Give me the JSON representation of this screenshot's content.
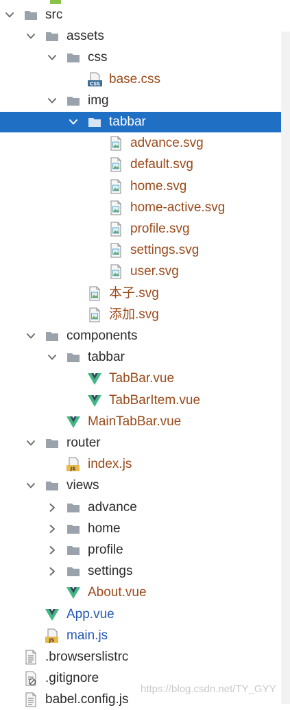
{
  "tree": [
    {
      "label": "src",
      "depth": 0,
      "kind": "folder",
      "state": "expanded",
      "color": "normal",
      "icon": "folder-icon"
    },
    {
      "label": "assets",
      "depth": 1,
      "kind": "folder",
      "state": "expanded",
      "color": "normal",
      "icon": "folder-icon"
    },
    {
      "label": "css",
      "depth": 2,
      "kind": "folder",
      "state": "expanded",
      "color": "normal",
      "icon": "folder-icon"
    },
    {
      "label": "base.css",
      "depth": 3,
      "kind": "file",
      "state": "none",
      "color": "modified",
      "icon": "css-file-icon"
    },
    {
      "label": "img",
      "depth": 2,
      "kind": "folder",
      "state": "expanded",
      "color": "normal",
      "icon": "folder-icon"
    },
    {
      "label": "tabbar",
      "depth": 3,
      "kind": "folder",
      "state": "expanded",
      "color": "normal",
      "icon": "folder-icon",
      "selected": true
    },
    {
      "label": "advance.svg",
      "depth": 4,
      "kind": "file",
      "state": "none",
      "color": "modified",
      "icon": "image-file-icon"
    },
    {
      "label": "default.svg",
      "depth": 4,
      "kind": "file",
      "state": "none",
      "color": "modified",
      "icon": "image-file-icon"
    },
    {
      "label": "home.svg",
      "depth": 4,
      "kind": "file",
      "state": "none",
      "color": "modified",
      "icon": "image-file-icon"
    },
    {
      "label": "home-active.svg",
      "depth": 4,
      "kind": "file",
      "state": "none",
      "color": "modified",
      "icon": "image-file-icon"
    },
    {
      "label": "profile.svg",
      "depth": 4,
      "kind": "file",
      "state": "none",
      "color": "modified",
      "icon": "image-file-icon"
    },
    {
      "label": "settings.svg",
      "depth": 4,
      "kind": "file",
      "state": "none",
      "color": "modified",
      "icon": "image-file-icon"
    },
    {
      "label": "user.svg",
      "depth": 4,
      "kind": "file",
      "state": "none",
      "color": "modified",
      "icon": "image-file-icon"
    },
    {
      "label": "本子.svg",
      "depth": 3,
      "kind": "file",
      "state": "none",
      "color": "modified",
      "icon": "image-file-icon"
    },
    {
      "label": "添加.svg",
      "depth": 3,
      "kind": "file",
      "state": "none",
      "color": "modified",
      "icon": "image-file-icon"
    },
    {
      "label": "components",
      "depth": 1,
      "kind": "folder",
      "state": "expanded",
      "color": "normal",
      "icon": "folder-icon"
    },
    {
      "label": "tabbar",
      "depth": 2,
      "kind": "folder",
      "state": "expanded",
      "color": "normal",
      "icon": "folder-icon"
    },
    {
      "label": "TabBar.vue",
      "depth": 3,
      "kind": "file",
      "state": "none",
      "color": "modified",
      "icon": "vue-file-icon"
    },
    {
      "label": "TabBarItem.vue",
      "depth": 3,
      "kind": "file",
      "state": "none",
      "color": "modified",
      "icon": "vue-file-icon"
    },
    {
      "label": "MainTabBar.vue",
      "depth": 2,
      "kind": "file",
      "state": "none",
      "color": "modified",
      "icon": "vue-file-icon"
    },
    {
      "label": "router",
      "depth": 1,
      "kind": "folder",
      "state": "expanded",
      "color": "normal",
      "icon": "folder-icon"
    },
    {
      "label": "index.js",
      "depth": 2,
      "kind": "file",
      "state": "none",
      "color": "modified",
      "icon": "js-file-icon"
    },
    {
      "label": "views",
      "depth": 1,
      "kind": "folder",
      "state": "expanded",
      "color": "normal",
      "icon": "folder-icon"
    },
    {
      "label": "advance",
      "depth": 2,
      "kind": "folder",
      "state": "collapsed",
      "color": "normal",
      "icon": "folder-icon"
    },
    {
      "label": "home",
      "depth": 2,
      "kind": "folder",
      "state": "collapsed",
      "color": "normal",
      "icon": "folder-icon"
    },
    {
      "label": "profile",
      "depth": 2,
      "kind": "folder",
      "state": "collapsed",
      "color": "normal",
      "icon": "folder-icon"
    },
    {
      "label": "settings",
      "depth": 2,
      "kind": "folder",
      "state": "collapsed",
      "color": "normal",
      "icon": "folder-icon"
    },
    {
      "label": "About.vue",
      "depth": 2,
      "kind": "file",
      "state": "none",
      "color": "modified",
      "icon": "vue-file-icon"
    },
    {
      "label": "App.vue",
      "depth": 1,
      "kind": "file",
      "state": "none",
      "color": "new",
      "icon": "vue-file-icon"
    },
    {
      "label": "main.js",
      "depth": 1,
      "kind": "file",
      "state": "none",
      "color": "new",
      "icon": "js-file-icon"
    },
    {
      "label": ".browserslistrc",
      "depth": 0,
      "kind": "file",
      "state": "none",
      "color": "normal",
      "icon": "text-file-icon"
    },
    {
      "label": ".gitignore",
      "depth": 0,
      "kind": "file",
      "state": "none",
      "color": "normal",
      "icon": "ignored-file-icon"
    },
    {
      "label": "babel.config.js",
      "depth": 0,
      "kind": "file",
      "state": "none",
      "color": "normal",
      "icon": "text-file-icon"
    }
  ],
  "watermark": "https://blog.csdn.net/TY_GYY",
  "colors": {
    "selection": "#1f6fc5",
    "modified_text": "#9a4a1a",
    "new_text": "#2457b4",
    "folder": "#9aa3ab",
    "vue_green": "#41b883",
    "vue_dark": "#35495e"
  }
}
